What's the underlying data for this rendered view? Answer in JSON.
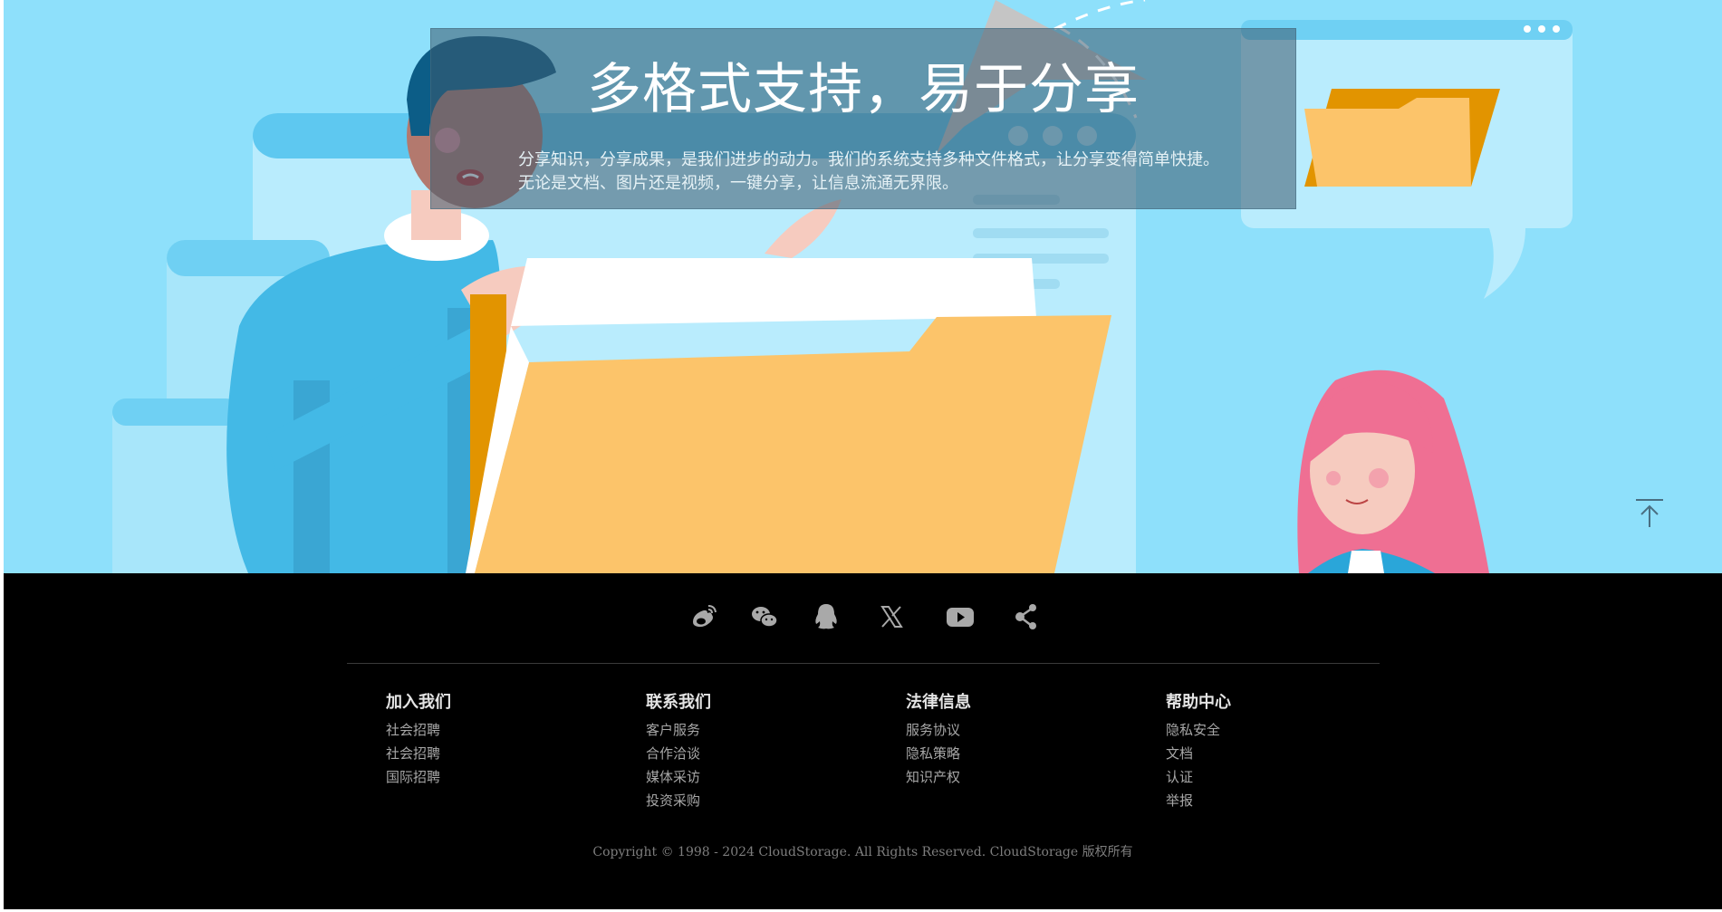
{
  "banner": {
    "title": "多格式支持，易于分享",
    "description": "分享知识，分享成果，是我们进步的动力。我们的系统支持多种文件格式，让分享变得简单快捷。无论是文档、图片还是视频，一键分享，让信息流通无界限。"
  },
  "social_icons": [
    "weibo-icon",
    "wechat-icon",
    "qq-icon",
    "x-icon",
    "youtube-icon",
    "share-icon"
  ],
  "footer": {
    "columns": [
      {
        "title": "加入我们",
        "links": [
          "社会招聘",
          "社会招聘",
          "国际招聘"
        ]
      },
      {
        "title": "联系我们",
        "links": [
          "客户服务",
          "合作洽谈",
          "媒体采访",
          "投资采购"
        ]
      },
      {
        "title": "法律信息",
        "links": [
          "服务协议",
          "隐私策略",
          "知识产权"
        ]
      },
      {
        "title": "帮助中心",
        "links": [
          "隐私安全",
          "文档",
          "认证",
          "举报"
        ]
      }
    ],
    "copyright": "Copyright © 1998 - 2024 CloudStorage. All Rights Reserved. CloudStorage 版权所有"
  },
  "colors": {
    "hero_bg": "#8ee0fb",
    "footer_bg": "#000000",
    "folder_yellow": "#fcc46a",
    "folder_orange": "#e29400"
  }
}
